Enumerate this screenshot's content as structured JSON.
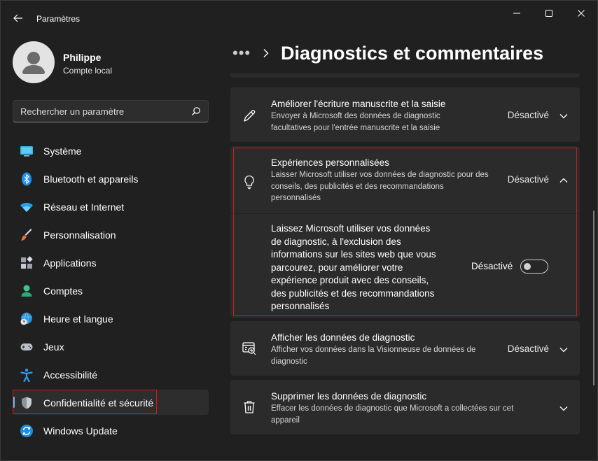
{
  "window": {
    "app_title": "Paramètres",
    "controls": [
      "minimize",
      "maximize",
      "close"
    ]
  },
  "profile": {
    "name": "Philippe",
    "account_type": "Compte local"
  },
  "search": {
    "placeholder": "Rechercher un paramètre",
    "value": ""
  },
  "sidebar": {
    "items": [
      {
        "label": "Système",
        "icon": "system-icon"
      },
      {
        "label": "Bluetooth et appareils",
        "icon": "bluetooth-icon"
      },
      {
        "label": "Réseau et Internet",
        "icon": "wifi-icon"
      },
      {
        "label": "Personnalisation",
        "icon": "brush-icon"
      },
      {
        "label": "Applications",
        "icon": "apps-icon"
      },
      {
        "label": "Comptes",
        "icon": "account-icon"
      },
      {
        "label": "Heure et langue",
        "icon": "globe-clock-icon"
      },
      {
        "label": "Jeux",
        "icon": "gamepad-icon"
      },
      {
        "label": "Accessibilité",
        "icon": "accessibility-icon"
      },
      {
        "label": "Confidentialité et sécurité",
        "icon": "shield-icon",
        "active": true
      },
      {
        "label": "Windows Update",
        "icon": "update-icon"
      }
    ]
  },
  "header": {
    "breadcrumb_more": "•••",
    "title": "Diagnostics et commentaires"
  },
  "cards": {
    "handwriting": {
      "title": "Améliorer l'écriture manuscrite et la saisie",
      "description": "Envoyer à Microsoft des données de diagnostic facultatives pour l'entrée manuscrite et la saisie",
      "state": "Désactivé",
      "icon": "pen-icon"
    },
    "tailored": {
      "title": "Expériences personnalisées",
      "description": "Laisser Microsoft utiliser vos données de diagnostic pour des conseils, des publicités et des recommandations personnalisés",
      "state": "Désactivé",
      "icon": "lightbulb-icon",
      "expanded": true,
      "detail_text": "Laissez Microsoft utiliser vos données de diagnostic, à l'exclusion des informations sur les sites web que vous parcourez, pour améliorer votre expérience produit avec des conseils, des publicités et des recommandations personnalisés",
      "toggle_label": "Désactivé",
      "toggle_on": false
    },
    "view_data": {
      "title": "Afficher les données de diagnostic",
      "description": "Afficher vos données dans la Visionneuse de données de diagnostic",
      "state": "Désactivé",
      "icon": "diagnostic-viewer-icon"
    },
    "delete_data": {
      "title": "Supprimer les données de diagnostic",
      "description": "Effacer les données de diagnostic que Microsoft a collectées sur cet appareil",
      "icon": "trash-icon"
    }
  },
  "colors": {
    "background": "#202020",
    "card": "#2b2b2b",
    "accent": "#4cc2ff",
    "highlight": "#d11a1a"
  }
}
